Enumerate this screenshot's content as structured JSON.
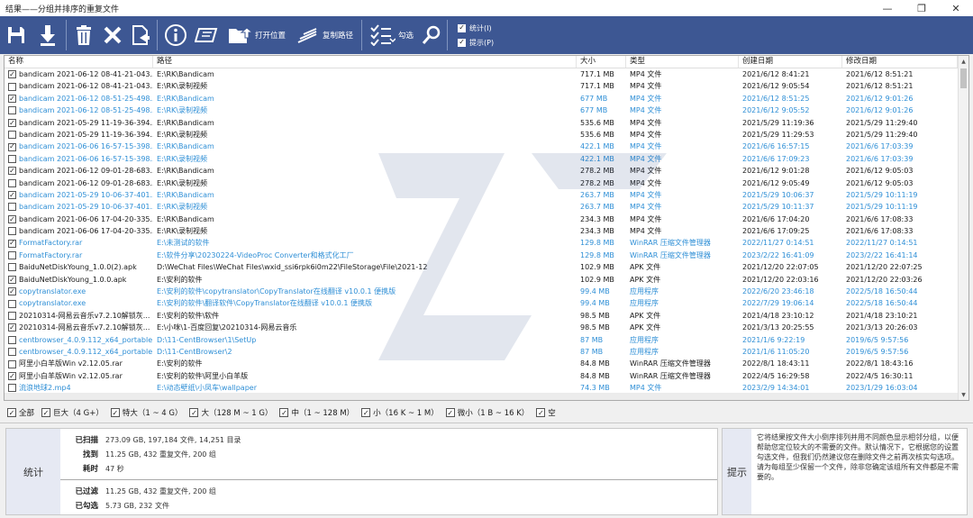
{
  "window": {
    "title": "结果——分组并排序的重复文件"
  },
  "toolbar": {
    "open_location": "打开位置",
    "copy_path": "复制路径",
    "check": "勾选",
    "opt_stats": "统计(I)",
    "opt_hint": "提示(P)"
  },
  "columns": [
    "名称",
    "路径",
    "大小",
    "类型",
    "创建日期",
    "修改日期"
  ],
  "rows": [
    {
      "checked": true,
      "blue": false,
      "name": "bandicam 2021-06-12 08-41-21-043....",
      "path": "E:\\RK\\Bandicam",
      "size": "717.1 MB",
      "type": "MP4 文件",
      "created": "2021/6/12 8:41:21",
      "modified": "2021/6/12 8:51:21"
    },
    {
      "checked": false,
      "blue": false,
      "name": "bandicam 2021-06-12 08-41-21-043....",
      "path": "E:\\RK\\录制视频",
      "size": "717.1 MB",
      "type": "MP4 文件",
      "created": "2021/6/12 9:05:54",
      "modified": "2021/6/12 8:51:21"
    },
    {
      "checked": true,
      "blue": true,
      "name": "bandicam 2021-06-12 08-51-25-498....",
      "path": "E:\\RK\\Bandicam",
      "size": "677 MB",
      "type": "MP4 文件",
      "created": "2021/6/12 8:51:25",
      "modified": "2021/6/12 9:01:26"
    },
    {
      "checked": false,
      "blue": true,
      "name": "bandicam 2021-06-12 08-51-25-498....",
      "path": "E:\\RK\\录制视频",
      "size": "677 MB",
      "type": "MP4 文件",
      "created": "2021/6/12 9:05:52",
      "modified": "2021/6/12 9:01:26"
    },
    {
      "checked": true,
      "blue": false,
      "name": "bandicam 2021-05-29 11-19-36-394....",
      "path": "E:\\RK\\Bandicam",
      "size": "535.6 MB",
      "type": "MP4 文件",
      "created": "2021/5/29 11:19:36",
      "modified": "2021/5/29 11:29:40"
    },
    {
      "checked": false,
      "blue": false,
      "name": "bandicam 2021-05-29 11-19-36-394....",
      "path": "E:\\RK\\录制视频",
      "size": "535.6 MB",
      "type": "MP4 文件",
      "created": "2021/5/29 11:29:53",
      "modified": "2021/5/29 11:29:40"
    },
    {
      "checked": true,
      "blue": true,
      "name": "bandicam 2021-06-06 16-57-15-398....",
      "path": "E:\\RK\\Bandicam",
      "size": "422.1 MB",
      "type": "MP4 文件",
      "created": "2021/6/6 16:57:15",
      "modified": "2021/6/6 17:03:39"
    },
    {
      "checked": false,
      "blue": true,
      "name": "bandicam 2021-06-06 16-57-15-398....",
      "path": "E:\\RK\\录制视频",
      "size": "422.1 MB",
      "type": "MP4 文件",
      "created": "2021/6/6 17:09:23",
      "modified": "2021/6/6 17:03:39"
    },
    {
      "checked": true,
      "blue": false,
      "name": "bandicam 2021-06-12 09-01-28-683....",
      "path": "E:\\RK\\Bandicam",
      "size": "278.2 MB",
      "type": "MP4 文件",
      "created": "2021/6/12 9:01:28",
      "modified": "2021/6/12 9:05:03"
    },
    {
      "checked": false,
      "blue": false,
      "name": "bandicam 2021-06-12 09-01-28-683....",
      "path": "E:\\RK\\录制视频",
      "size": "278.2 MB",
      "type": "MP4 文件",
      "created": "2021/6/12 9:05:49",
      "modified": "2021/6/12 9:05:03"
    },
    {
      "checked": true,
      "blue": true,
      "name": "bandicam 2021-05-29 10-06-37-401....",
      "path": "E:\\RK\\Bandicam",
      "size": "263.7 MB",
      "type": "MP4 文件",
      "created": "2021/5/29 10:06:37",
      "modified": "2021/5/29 10:11:19"
    },
    {
      "checked": false,
      "blue": true,
      "name": "bandicam 2021-05-29 10-06-37-401....",
      "path": "E:\\RK\\录制视频",
      "size": "263.7 MB",
      "type": "MP4 文件",
      "created": "2021/5/29 10:11:37",
      "modified": "2021/5/29 10:11:19"
    },
    {
      "checked": true,
      "blue": false,
      "name": "bandicam 2021-06-06 17-04-20-335....",
      "path": "E:\\RK\\Bandicam",
      "size": "234.3 MB",
      "type": "MP4 文件",
      "created": "2021/6/6 17:04:20",
      "modified": "2021/6/6 17:08:33"
    },
    {
      "checked": false,
      "blue": false,
      "name": "bandicam 2021-06-06 17-04-20-335....",
      "path": "E:\\RK\\录制视频",
      "size": "234.3 MB",
      "type": "MP4 文件",
      "created": "2021/6/6 17:09:25",
      "modified": "2021/6/6 17:08:33"
    },
    {
      "checked": true,
      "blue": true,
      "name": "FormatFactory.rar",
      "path": "E:\\未测试的软件",
      "size": "129.8 MB",
      "type": "WinRAR 压缩文件管理器",
      "created": "2022/11/27 0:14:51",
      "modified": "2022/11/27 0:14:51"
    },
    {
      "checked": false,
      "blue": true,
      "name": "FormatFactory.rar",
      "path": "E:\\软件分享\\20230224-VideoProc Converter和格式化工厂",
      "size": "129.8 MB",
      "type": "WinRAR 压缩文件管理器",
      "created": "2023/2/22 16:41:09",
      "modified": "2023/2/22 16:41:14"
    },
    {
      "checked": false,
      "blue": false,
      "name": "BaiduNetDiskYoung_1.0.0(2).apk",
      "path": "D:\\WeChat Files\\WeChat Files\\wxid_ssi6rpk6i0m22\\FileStorage\\File\\2021-12",
      "size": "102.9 MB",
      "type": "APK 文件",
      "created": "2021/12/20 22:07:05",
      "modified": "2021/12/20 22:07:25"
    },
    {
      "checked": true,
      "blue": false,
      "name": "BaiduNetDiskYoung_1.0.0.apk",
      "path": "E:\\安利的软件",
      "size": "102.9 MB",
      "type": "APK 文件",
      "created": "2021/12/20 22:03:16",
      "modified": "2021/12/20 22:03:26"
    },
    {
      "checked": true,
      "blue": true,
      "name": "copytranslator.exe",
      "path": "E:\\安利的软件\\copytranslator\\CopyTranslator在线翻译 v10.0.1 便携版",
      "size": "99.4 MB",
      "type": "应用程序",
      "created": "2022/6/20 23:46:18",
      "modified": "2022/5/18 16:50:44"
    },
    {
      "checked": false,
      "blue": true,
      "name": "copytranslator.exe",
      "path": "E:\\安利的软件\\翻译软件\\CopyTranslator在线翻译 v10.0.1 便携版",
      "size": "99.4 MB",
      "type": "应用程序",
      "created": "2022/7/29 19:06:14",
      "modified": "2022/5/18 16:50:44"
    },
    {
      "checked": false,
      "blue": false,
      "name": "20210314-网易云音乐v7.2.10解锁灰...",
      "path": "E:\\安利的软件\\软件",
      "size": "98.5 MB",
      "type": "APK 文件",
      "created": "2021/4/18 23:10:12",
      "modified": "2021/4/18 23:10:21"
    },
    {
      "checked": true,
      "blue": false,
      "name": "20210314-网易云音乐v7.2.10解锁灰...",
      "path": "E:\\小咪\\1-百度回复\\20210314-网易云音乐",
      "size": "98.5 MB",
      "type": "APK 文件",
      "created": "2021/3/13 20:25:55",
      "modified": "2021/3/13 20:26:03"
    },
    {
      "checked": false,
      "blue": true,
      "name": "centbrowser_4.0.9.112_x64_portable....",
      "path": "D:\\11-CentBrowser\\1\\SetUp",
      "size": "87 MB",
      "type": "应用程序",
      "created": "2021/1/6 9:22:19",
      "modified": "2019/6/5 9:57:56"
    },
    {
      "checked": false,
      "blue": true,
      "name": "centbrowser_4.0.9.112_x64_portable....",
      "path": "D:\\11-CentBrowser\\2",
      "size": "87 MB",
      "type": "应用程序",
      "created": "2021/1/6 11:05:20",
      "modified": "2019/6/5 9:57:56"
    },
    {
      "checked": false,
      "blue": false,
      "name": "阿里小白羊版Win v2.12.05.rar",
      "path": "E:\\安利的软件",
      "size": "84.8 MB",
      "type": "WinRAR 压缩文件管理器",
      "created": "2022/8/1 18:43:11",
      "modified": "2022/8/1 18:43:16"
    },
    {
      "checked": true,
      "blue": false,
      "name": "阿里小白羊版Win v2.12.05.rar",
      "path": "E:\\安利的软件\\阿里小白羊版",
      "size": "84.8 MB",
      "type": "WinRAR 压缩文件管理器",
      "created": "2022/4/5 16:29:58",
      "modified": "2022/4/5 16:30:11"
    },
    {
      "checked": false,
      "blue": true,
      "name": "流浪地球2.mp4",
      "path": "E:\\动态壁纸\\小凤车\\wallpaper",
      "size": "74.3 MB",
      "type": "MP4 文件",
      "created": "2023/2/9 14:34:01",
      "modified": "2023/1/29 16:03:04"
    }
  ],
  "filters": [
    {
      "label": "全部",
      "checked": true
    },
    {
      "label": "巨大（4 G+）",
      "checked": true
    },
    {
      "label": "特大（1 ~ 4 G）",
      "checked": true
    },
    {
      "label": "大（128 M ~ 1 G）",
      "checked": true
    },
    {
      "label": "中（1 ~ 128 M）",
      "checked": true
    },
    {
      "label": "小（16 K ~ 1 M）",
      "checked": true
    },
    {
      "label": "微小（1 B ~ 16 K）",
      "checked": true
    },
    {
      "label": "空",
      "checked": true
    }
  ],
  "stats": {
    "label": "统计",
    "scanned_k": "已扫描",
    "scanned_v": "273.09 GB, 197,184 文件, 14,251 目录",
    "found_k": "找到",
    "found_v": "11.25 GB, 432 重复文件, 200 组",
    "time_k": "耗时",
    "time_v": "47 秒",
    "filtered_k": "已过滤",
    "filtered_v": "11.25 GB, 432 重复文件, 200 组",
    "checked_k": "已勾选",
    "checked_v": "5.73 GB, 232 文件"
  },
  "hint": {
    "label": "提示",
    "text": "它将结果按文件大小倒序排列并用不同颜色显示相邻分组，以便帮助您定位较大的不需要的文件。默认情况下，它根据您的设置勾选文件，但我们仍然建议您在删除文件之前再次核实勾选项。请为每组至少保留一个文件，除非您确定该组所有文件都是不需要的。"
  },
  "colors": {
    "toolbar": "#3d5793",
    "group_blue": "#2f8fd6"
  },
  "icons": [
    "save-icon",
    "download-icon",
    "trash-icon",
    "close-icon",
    "export-icon",
    "info-icon",
    "rename-icon",
    "open-folder-icon",
    "copy-path-icon",
    "check-list-icon",
    "search-icon"
  ]
}
